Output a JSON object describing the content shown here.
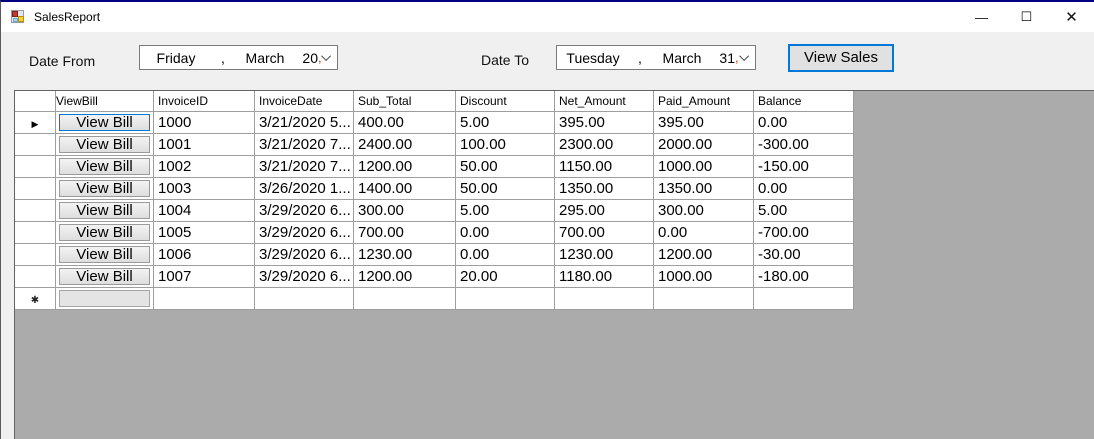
{
  "window": {
    "title": "SalesReport",
    "minimize_glyph": "—",
    "maximize_glyph": "☐",
    "close_glyph": "✕"
  },
  "toolbar": {
    "date_from_label": "Date From",
    "date_to_label": "Date To",
    "view_sales_label": "View Sales",
    "date_from": {
      "day_name": "Friday",
      "comma": ",",
      "month": "March",
      "day": "20",
      "trailing_comma": ","
    },
    "date_to": {
      "day_name": "Tuesday",
      "comma": ",",
      "month": "March",
      "day": "31",
      "trailing_comma": ","
    }
  },
  "grid": {
    "columns": [
      "ViewBill",
      "InvoiceID",
      "InvoiceDate",
      "Sub_Total",
      "Discount",
      "Net_Amount",
      "Paid_Amount",
      "Balance"
    ],
    "button_label": "View Bill",
    "current_row_indicator": "▶",
    "new_row_indicator": "✱",
    "rows": [
      {
        "current": true,
        "invoice_id": "1000",
        "invoice_date": "3/21/2020 5...",
        "sub_total": "400.00",
        "discount": "5.00",
        "net_amount": "395.00",
        "paid_amount": "395.00",
        "balance": "0.00"
      },
      {
        "current": false,
        "invoice_id": "1001",
        "invoice_date": "3/21/2020 7...",
        "sub_total": "2400.00",
        "discount": "100.00",
        "net_amount": "2300.00",
        "paid_amount": "2000.00",
        "balance": "-300.00"
      },
      {
        "current": false,
        "invoice_id": "1002",
        "invoice_date": "3/21/2020 7...",
        "sub_total": "1200.00",
        "discount": "50.00",
        "net_amount": "1150.00",
        "paid_amount": "1000.00",
        "balance": "-150.00"
      },
      {
        "current": false,
        "invoice_id": "1003",
        "invoice_date": "3/26/2020 1...",
        "sub_total": "1400.00",
        "discount": "50.00",
        "net_amount": "1350.00",
        "paid_amount": "1350.00",
        "balance": "0.00"
      },
      {
        "current": false,
        "invoice_id": "1004",
        "invoice_date": "3/29/2020 6...",
        "sub_total": "300.00",
        "discount": "5.00",
        "net_amount": "295.00",
        "paid_amount": "300.00",
        "balance": "5.00"
      },
      {
        "current": false,
        "invoice_id": "1005",
        "invoice_date": "3/29/2020 6...",
        "sub_total": "700.00",
        "discount": "0.00",
        "net_amount": "700.00",
        "paid_amount": "0.00",
        "balance": "-700.00"
      },
      {
        "current": false,
        "invoice_id": "1006",
        "invoice_date": "3/29/2020 6...",
        "sub_total": "1230.00",
        "discount": "0.00",
        "net_amount": "1230.00",
        "paid_amount": "1200.00",
        "balance": "-30.00"
      },
      {
        "current": false,
        "invoice_id": "1007",
        "invoice_date": "3/29/2020 6...",
        "sub_total": "1200.00",
        "discount": "20.00",
        "net_amount": "1180.00",
        "paid_amount": "1000.00",
        "balance": "-180.00"
      }
    ]
  },
  "colors": {
    "accent": "#0078d7",
    "titlebar_top_border": "#000080",
    "grid_background": "#ababab",
    "form_background": "#f0f0f0",
    "red_comma": "#c1440e"
  }
}
